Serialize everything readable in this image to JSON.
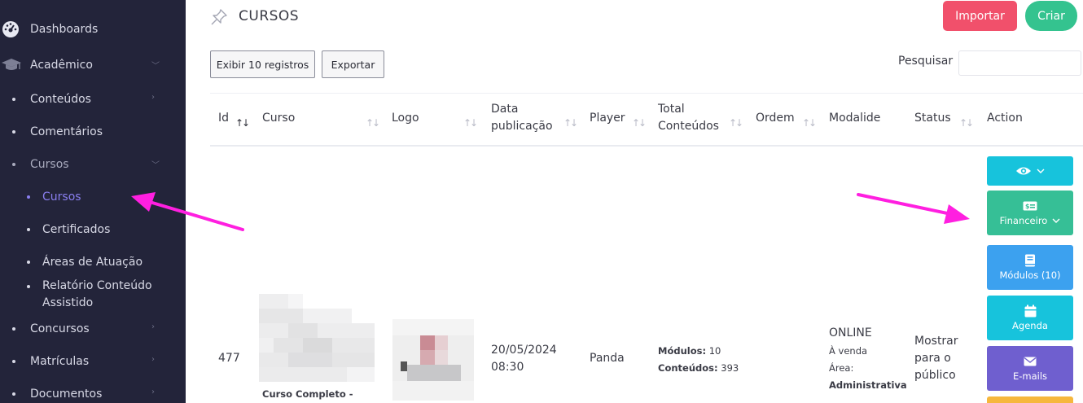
{
  "sidebar": {
    "items": [
      {
        "label": "Dashboards"
      },
      {
        "label": "Acadêmico"
      },
      {
        "label": "Conteúdos"
      },
      {
        "label": "Comentários"
      },
      {
        "label": "Cursos"
      },
      {
        "label": "Cursos"
      },
      {
        "label": "Certificados"
      },
      {
        "label": "Áreas de Atuação"
      },
      {
        "label": "Relatório Conteúdo Assistido",
        "line1": "Relatório Conteúdo",
        "line2": "Assistido"
      },
      {
        "label": "Concursos"
      },
      {
        "label": "Matrículas"
      },
      {
        "label": "Documentos"
      }
    ]
  },
  "header": {
    "title": "CURSOS",
    "importar_label": "Importar",
    "criar_label": "Criar"
  },
  "toolbar": {
    "show_label": "Exibir 10 registros",
    "export_label": "Exportar",
    "search_label": "Pesquisar",
    "search_value": ""
  },
  "table": {
    "columns": {
      "id": "Id",
      "curso": "Curso",
      "logo": "Logo",
      "data_l1": "Data",
      "data_l2": "publicação",
      "player": "Player",
      "total_l1": "Total",
      "total_l2": "Conteúdos",
      "ordem": "Ordem",
      "modalidade": "Modalide",
      "status": "Status",
      "action": "Action"
    },
    "row": {
      "id": "477",
      "curso_caption": "Curso Completo -",
      "data_l1": "20/05/2024",
      "data_l2": "08:30",
      "player": "Panda",
      "modulos_label": "Módulos:",
      "modulos_value": "10",
      "conteudos_label": "Conteúdos:",
      "conteudos_value": "393",
      "modalidade": "ONLINE",
      "venda": "À venda",
      "area_label": "Área:",
      "area_value": "Administrativa",
      "status_l1": "Mostrar",
      "status_l2": "para o",
      "status_l3": "público"
    },
    "actions": {
      "financeiro": "Financeiro",
      "modulos": "Módulos (10)",
      "agenda": "Agenda",
      "emails": "E-mails"
    }
  },
  "colors": {
    "sidebar_bg": "#23243a",
    "active": "#8a7ff0",
    "importar": "#f1506b",
    "criar": "#34c38f",
    "cyan": "#17c3dc",
    "green": "#36bf96",
    "blue": "#3ca1ef",
    "purple": "#6f5fcf",
    "annotation_arrow": "#ff1fe0"
  }
}
